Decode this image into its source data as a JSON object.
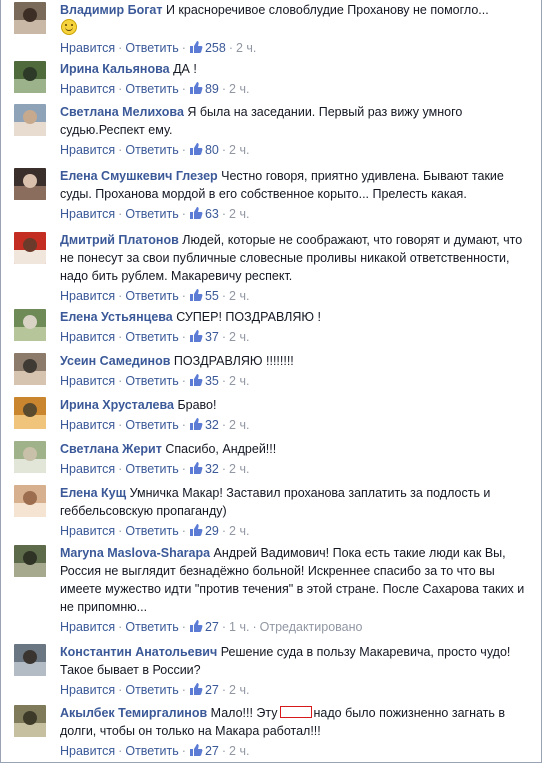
{
  "labels": {
    "like": "Нравится",
    "reply": "Ответить",
    "sep": "·"
  },
  "colors": {
    "link": "#3b5998",
    "meta": "#9197a3",
    "text": "#141823"
  },
  "comments": [
    {
      "author": "Владимир Богат",
      "text": "И красноречивое словоблудие Проханову не помогло...",
      "likes": "258",
      "time": "2 ч.",
      "edited": "",
      "avatar": [
        "#7a6a5a",
        "#c9b8a6",
        "#3d2e25"
      ]
    },
    {
      "author": "Ирина Кальянова",
      "text": "ДА !",
      "likes": "89",
      "time": "2 ч.",
      "edited": "",
      "avatar": [
        "#4f6b3c",
        "#9bb28a",
        "#2e3a28"
      ]
    },
    {
      "author": "Светлана Мелихова",
      "text": "Я была на заседании. Первый раз вижу умного судью.Респект ему.",
      "likes": "80",
      "time": "2 ч.",
      "edited": "",
      "avatar": [
        "#8fa3b8",
        "#e8dcd0",
        "#c7a98e"
      ]
    },
    {
      "author": "Елена Смушкевич Глезер",
      "text": "Честно говоря, приятно удивлена. Бывают такие суды. Проханова мордой в его собственное корыто... Прелесть какая.",
      "likes": "63",
      "time": "2 ч.",
      "edited": "",
      "avatar": [
        "#3a2f2a",
        "#8a6d5c",
        "#d9c1ad"
      ]
    },
    {
      "author": "Дмитрий Платонов",
      "text": "Людей, которые не соображают, что говорят и думают, что не понесут за свои публичные словесные проливы никакой ответственности, надо бить рублем. Макаревичу респект.",
      "likes": "55",
      "time": "2 ч.",
      "edited": "",
      "avatar": [
        "#c42d22",
        "#f0e6dc",
        "#6b3a2b"
      ]
    },
    {
      "author": "Елена Устьянцева",
      "text": "СУПЕР! ПОЗДРАВЛЯЮ !",
      "likes": "37",
      "time": "2 ч.",
      "edited": "",
      "avatar": [
        "#6d8a57",
        "#b7c69a",
        "#d8d3c4"
      ]
    },
    {
      "author": "Усеин Самединов",
      "text": "ПОЗДРАВЛЯЮ !!!!!!!!",
      "likes": "35",
      "time": "2 ч.",
      "edited": "",
      "avatar": [
        "#8c7b6a",
        "#d6c4b0",
        "#3f3a34"
      ]
    },
    {
      "author": "Ирина Хрусталева",
      "text": "Браво!",
      "likes": "32",
      "time": "2 ч.",
      "edited": "",
      "avatar": [
        "#c9862f",
        "#f0c47a",
        "#5a4a2e"
      ]
    },
    {
      "author": "Светлана Жерит",
      "text": "Спасибо, Андрей!!!",
      "likes": "32",
      "time": "2 ч.",
      "edited": "",
      "avatar": [
        "#9fb28a",
        "#e2e6d8",
        "#c8c0a8"
      ]
    },
    {
      "author": "Елена Кущ",
      "text": "Умничка Макар! Заставил проханова заплатить за подлость и геббельсовскую пропаганду)",
      "likes": "29",
      "time": "2 ч.",
      "edited": "",
      "avatar": [
        "#d7b08f",
        "#f5e4d2",
        "#9c6e4f"
      ]
    },
    {
      "author": "Maryna Maslova-Sharapa",
      "text": "Андрей Вадимович! Пока есть такие люди как Вы, Россия не выглядит безнадёжно больной! Искреннее спасибо за то что вы имеете мужество идти \"против течения\" в этой стране. После Сахарова таких и не припомню...",
      "likes": "27",
      "time": "1 ч.",
      "edited": "Отредактировано",
      "avatar": [
        "#5e6b4a",
        "#a7a98e",
        "#2f3326"
      ]
    },
    {
      "author": "Константин Анатольевич",
      "text": "Решение суда в пользу Макаревича, просто чудо! Такое бывает в России?",
      "likes": "27",
      "time": "2 ч.",
      "edited": "",
      "avatar": [
        "#6a7682",
        "#b3bcc4",
        "#3a3430"
      ]
    },
    {
      "author": "Акылбек Темиргалинов",
      "text_before": "Мало!!! Эту",
      "text_after": "надо было пожизненно загнать в долги, чтобы он только на Макара работал!!!",
      "likes": "27",
      "time": "2 ч.",
      "edited": "",
      "avatar": [
        "#7f7a5a",
        "#c7c0a0",
        "#3d3a2a"
      ]
    }
  ]
}
